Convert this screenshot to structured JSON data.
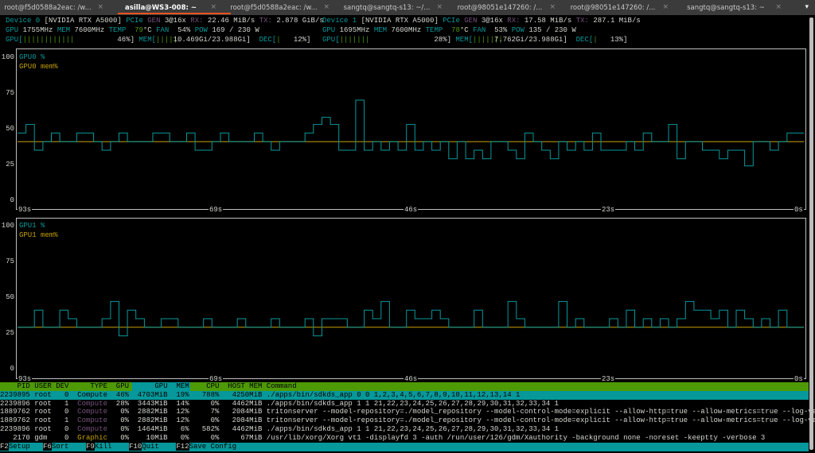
{
  "tabs": [
    {
      "label": "root@f5d0588a2eac: /w...",
      "active": false
    },
    {
      "label": "asilla@WS3-008: ~",
      "active": true
    },
    {
      "label": "root@f5d0588a2eac: /w...",
      "active": false
    },
    {
      "label": "sangtq@sangtq-s13: ~/...",
      "active": false
    },
    {
      "label": "root@98051e147260: /...",
      "active": false
    },
    {
      "label": "root@98051e147260: /...",
      "active": false
    },
    {
      "label": "sangtq@sangtq-s13: ~",
      "active": false
    }
  ],
  "tab_close": "×",
  "tab_menu": "▾",
  "devices": [
    {
      "name": "Device 0",
      "model": "[NVIDIA RTX A5000]",
      "pcie": "PCIe",
      "gen_label": "GEN",
      "gen": "3@16x",
      "rx_label": "RX:",
      "rx": "22.46 MiB/s",
      "tx_label": "TX:",
      "tx": "2.878 GiB/s",
      "gpu_label": "GPU",
      "gpu_clock": "1755MHz",
      "mem_label": "MEM",
      "mem_clock": "7600MHz",
      "temp_label": "TEMP",
      "temp": "79",
      "temp_unit": "°C",
      "fan_label": "FAN",
      "fan": "54%",
      "pow_label": "POW",
      "pow": "169 / 230 W",
      "util_label": "GPU[",
      "util_bar": "||||||||||||",
      "util": "46%]",
      "util_pct": 46,
      "memu_label": "MEM[",
      "memu_bar": "|||||",
      "memu": "10.469Gi/23.988Gi]",
      "mem_pct": 43.6,
      "dec_label": "DEC[",
      "dec_bar": "|",
      "dec": "12%]",
      "dec_pct": 12
    },
    {
      "name": "Device 1",
      "model": "[NVIDIA RTX A5000]",
      "pcie": "PCIe",
      "gen_label": "GEN",
      "gen": "3@16x",
      "rx_label": "RX:",
      "rx": "17.58 MiB/s",
      "tx_label": "TX:",
      "tx": "287.1 MiB/s",
      "gpu_label": "GPU",
      "gpu_clock": "1695MHz",
      "mem_label": "MEM",
      "mem_clock": "7600MHz",
      "temp_label": "TEMP",
      "temp": "78",
      "temp_unit": "°C",
      "fan_label": "FAN",
      "fan": "53%",
      "pow_label": "POW",
      "pow": "135 / 230 W",
      "util_label": "GPU[",
      "util_bar": "|||||||",
      "util": "28%]",
      "util_pct": 28,
      "memu_label": "MEM[",
      "memu_bar": "|||||||",
      "memu": "7.762Gi/23.988Gi]",
      "mem_pct": 32.4,
      "dec_label": "DEC[",
      "dec_bar": "|",
      "dec": "13%]",
      "dec_pct": 13
    }
  ],
  "chart_data": [
    {
      "type": "line",
      "title": "GPU0",
      "legend": [
        "GPU0 %",
        "GPU0 mem%"
      ],
      "legend_placement": "top-left",
      "yticks": [
        "100",
        "75",
        "50",
        "25",
        "0"
      ],
      "ylim": [
        0,
        100
      ],
      "xticks": [
        "93s",
        "69s",
        "46s",
        "23s",
        "0s"
      ],
      "colors": {
        "util": "#06989a",
        "mem": "#c4a000"
      },
      "series": [
        {
          "name": "GPU0 %",
          "values": [
            47,
            53,
            35,
            41,
            47,
            41,
            41,
            47,
            47,
            41,
            35,
            41,
            47,
            41,
            41,
            41,
            47,
            47,
            41,
            41,
            47,
            35,
            35,
            41,
            47,
            41,
            41,
            41,
            47,
            41,
            35,
            41,
            41,
            41,
            47,
            53,
            58,
            53,
            35,
            35,
            70,
            35,
            41,
            35,
            41,
            35,
            53,
            35,
            41,
            35,
            41,
            29,
            41,
            29,
            35,
            29,
            41,
            41,
            35,
            29,
            47,
            41,
            35,
            29,
            41,
            35,
            41,
            35,
            47,
            35,
            35,
            35,
            41,
            35,
            47,
            41,
            41,
            53,
            29,
            41,
            41,
            35,
            35,
            29,
            35,
            35,
            24,
            41,
            41,
            35,
            41,
            47,
            47
          ]
        },
        {
          "name": "GPU0 mem%",
          "values": [
            41
          ]
        }
      ]
    },
    {
      "type": "line",
      "title": "GPU1",
      "legend": [
        "GPU1 %",
        "GPU1 mem%"
      ],
      "legend_placement": "top-left",
      "yticks": [
        "100",
        "75",
        "50",
        "25",
        "0"
      ],
      "ylim": [
        0,
        100
      ],
      "xticks": [
        "93s",
        "69s",
        "46s",
        "23s",
        "0s"
      ],
      "colors": {
        "util": "#06989a",
        "mem": "#c4a000"
      },
      "series": [
        {
          "name": "GPU1 %",
          "values": [
            29,
            29,
            41,
            29,
            29,
            41,
            35,
            29,
            29,
            29,
            35,
            47,
            23,
            41,
            35,
            29,
            29,
            35,
            35,
            29,
            29,
            29,
            35,
            29,
            29,
            29,
            35,
            29,
            29,
            29,
            35,
            29,
            29,
            29,
            35,
            23,
            35,
            35,
            35,
            29,
            29,
            41,
            35,
            47,
            29,
            29,
            41,
            35,
            35,
            41,
            35,
            29,
            29,
            29,
            41,
            29,
            29,
            29,
            47,
            35,
            29,
            29,
            29,
            29,
            47,
            29,
            35,
            29,
            29,
            29,
            35,
            29,
            41,
            29,
            35,
            29,
            35,
            29,
            35,
            47,
            41,
            41,
            35,
            41,
            29,
            41,
            35,
            29,
            35,
            29,
            41,
            29,
            29
          ]
        },
        {
          "name": "GPU1 mem%",
          "values": [
            29
          ]
        }
      ]
    }
  ],
  "processes": {
    "headers": [
      "PID",
      "USER",
      "DEV",
      "TYPE",
      "GPU",
      "GPU",
      "MEM",
      "CPU",
      "HOST MEM",
      "Command"
    ],
    "rows": [
      [
        "2239895",
        "root",
        "0",
        "Compute",
        "46%",
        "4703MiB",
        "19%",
        "788%",
        "4250MiB",
        "./apps/bin/sdkds_app 0 0 1,2,3,4,5,6,7,8,9,10,11,12,13,14 1"
      ],
      [
        "2239896",
        "root",
        "1",
        "Compute",
        "28%",
        "3443MiB",
        "14%",
        "0%",
        "4462MiB",
        "./apps/bin/sdkds_app 1 1 21,22,23,24,25,26,27,28,29,30,31,32,33,34 1"
      ],
      [
        "1889762",
        "root",
        "0",
        "Compute",
        "0%",
        "2882MiB",
        "12%",
        "7%",
        "2084MiB",
        "tritonserver --model-repository=./model_repository --model-control-mode=explicit --allow-http=true --allow-metrics=true --log-ve"
      ],
      [
        "1889762",
        "root",
        "1",
        "Compute",
        "0%",
        "2882MiB",
        "12%",
        "0%",
        "2084MiB",
        "tritonserver --model-repository=./model_repository --model-control-mode=explicit --allow-http=true --allow-metrics=true --log-ve"
      ],
      [
        "2239896",
        "root",
        "0",
        "Compute",
        "0%",
        "1464MiB",
        "6%",
        "582%",
        "4462MiB",
        "./apps/bin/sdkds_app 1 1 21,22,23,24,25,26,27,28,29,30,31,32,33,34 1"
      ],
      [
        "2170",
        "gdm",
        "0",
        "Graphic",
        "0%",
        "10MiB",
        "0%",
        "0%",
        "67MiB",
        "/usr/lib/xorg/Xorg vt1 -displayfd 3 -auth /run/user/126/gdm/Xauthority -background none -noreset -keeptty -verbose 3"
      ]
    ],
    "selected_row": 0
  },
  "footer": [
    {
      "key": "F2",
      "label": "Setup"
    },
    {
      "key": "F6",
      "label": "Sort"
    },
    {
      "key": "F9",
      "label": "Kill"
    },
    {
      "key": "F10",
      "label": "Quit"
    },
    {
      "key": "F12",
      "label": "Save Config"
    }
  ]
}
